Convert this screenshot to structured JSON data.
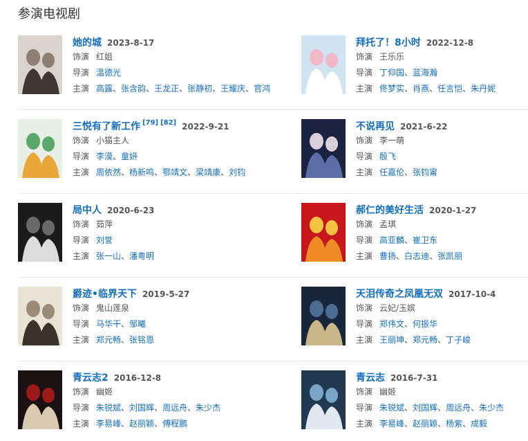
{
  "section_title": "参演电视剧",
  "labels": {
    "role": "饰演",
    "director": "导演",
    "cast": "主演"
  },
  "colors": {
    "link": "#136ec2",
    "text": "#555555",
    "divider": "#e8e8e8"
  },
  "dramas": [
    {
      "title": "她的城",
      "date": "2023-8-17",
      "refs": [],
      "role": [
        "红姐"
      ],
      "directors": [
        "温德光"
      ],
      "cast": [
        "高露",
        "张含韵",
        "王龙正",
        "张静初",
        "王耀庆",
        "官鸿"
      ]
    },
    {
      "title": "拜托了！8小时",
      "date": "2022-12-8",
      "refs": [],
      "role": [
        "王乐乐"
      ],
      "directors": [
        "丁仰国",
        "蓝海瀚"
      ],
      "cast": [
        "佟梦实",
        "肖燕",
        "任言恺",
        "朱丹妮"
      ]
    },
    {
      "title": "三悦有了新工作",
      "date": "2022-9-21",
      "refs": [
        "[79]",
        "[82]"
      ],
      "role": [
        "小猫主人"
      ],
      "directors": [
        "李漠",
        "童妍"
      ],
      "cast": [
        "周依然",
        "杨新鸣",
        "鄂靖文",
        "梁靖康",
        "刘钧"
      ]
    },
    {
      "title": "不说再见",
      "date": "2021-6-22",
      "refs": [],
      "role": [
        "李一萌"
      ],
      "directors": [
        "殷飞"
      ],
      "cast": [
        "任嘉伦",
        "张钧甯"
      ]
    },
    {
      "title": "局中人",
      "date": "2020-6-23",
      "refs": [],
      "role": [
        "茹萍"
      ],
      "directors": [
        "刘誉"
      ],
      "cast": [
        "张一山",
        "潘粤明"
      ]
    },
    {
      "title": "郝仁的美好生活",
      "date": "2020-1-27",
      "refs": [],
      "role": [
        "孟琪"
      ],
      "directors": [
        "高亚麟",
        "崔卫东"
      ],
      "cast": [
        "曹扬",
        "白志迪",
        "张凯丽"
      ]
    },
    {
      "title": "爵迹•临界天下",
      "date": "2019-5-27",
      "refs": [],
      "role": [
        "鬼山莲泉"
      ],
      "directors": [
        "马华干",
        "邹曦"
      ],
      "cast": [
        "郑元畅",
        "张铭恩"
      ]
    },
    {
      "title": "天泪传奇之凤凰无双",
      "date": "2017-10-4",
      "refs": [],
      "role": [
        "云妃/玉嫔"
      ],
      "directors": [
        "郑伟文",
        "何振华"
      ],
      "cast": [
        "王丽坤",
        "郑元畅",
        "丁子峻"
      ]
    },
    {
      "title": "青云志2",
      "date": "2016-12-8",
      "refs": [],
      "role": [
        "幽姬"
      ],
      "directors": [
        "朱锐斌",
        "刘国辉",
        "周远舟",
        "朱少杰"
      ],
      "cast": [
        "李易峰",
        "赵丽颖",
        "傅程鹏"
      ]
    },
    {
      "title": "青云志",
      "date": "2016-7-31",
      "refs": [],
      "role": [
        "幽姬"
      ],
      "directors": [
        "朱锐斌",
        "刘国辉",
        "周远舟",
        "朱少杰"
      ],
      "cast": [
        "李易峰",
        "赵丽颖",
        "杨紫",
        "成毅"
      ]
    }
  ]
}
